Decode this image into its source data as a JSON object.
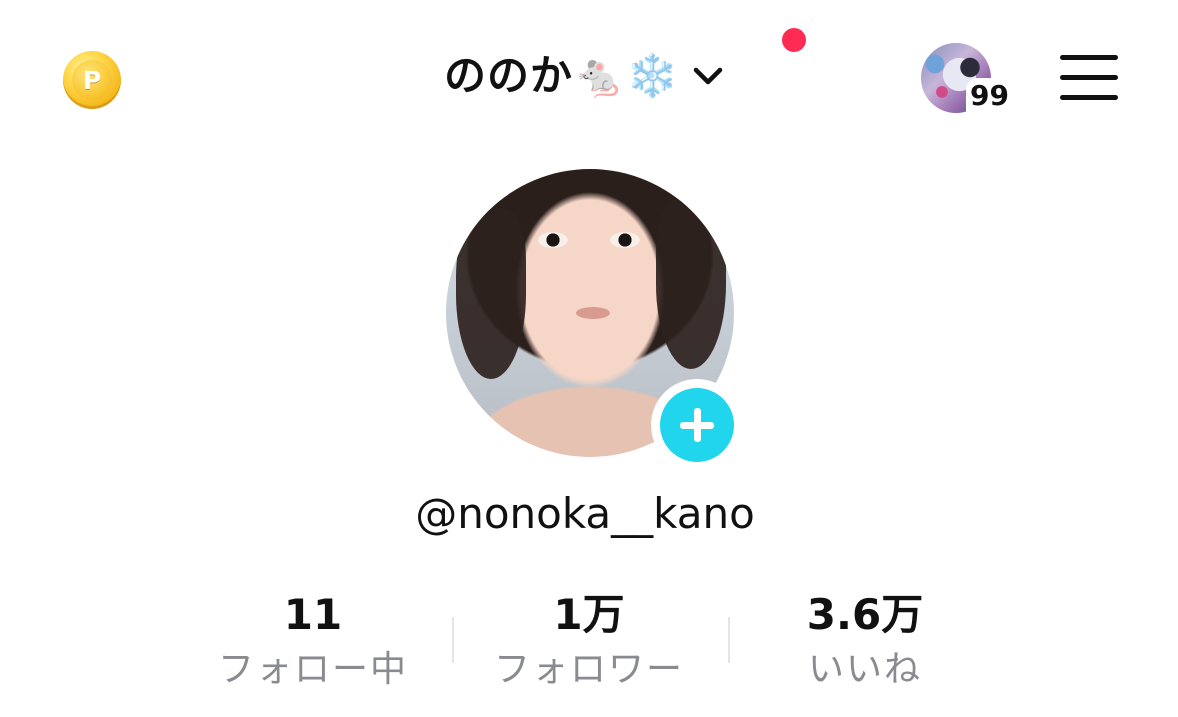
{
  "header": {
    "coin_letter": "P",
    "account_name": "ののか🐁❄️",
    "dropdown_icon": "chevron-down-icon",
    "notification_dot_color": "#fe2c55",
    "story_count": "99",
    "menu_icon": "hamburger-menu-icon"
  },
  "profile": {
    "username": "@nonoka__kano",
    "add_button_color": "#20d5ec"
  },
  "stats": [
    {
      "value": "11",
      "label": "フォロー中"
    },
    {
      "value": "1万",
      "label": "フォロワー"
    },
    {
      "value": "3.6万",
      "label": "いいね"
    }
  ]
}
